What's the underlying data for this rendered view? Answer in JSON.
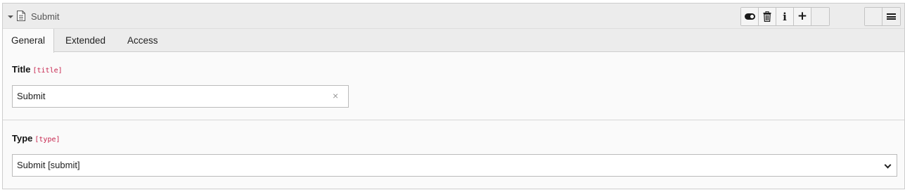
{
  "header": {
    "title": "Submit",
    "icons": [
      "collapse-caret-icon",
      "document-icon"
    ],
    "toolbar": [
      "toggle-visibility-icon",
      "trash-icon",
      "info-icon",
      "plus-icon",
      "blank",
      "blank",
      "menu-icon"
    ]
  },
  "tabs": [
    {
      "label": "General",
      "active": true
    },
    {
      "label": "Extended",
      "active": false
    },
    {
      "label": "Access",
      "active": false
    }
  ],
  "fields": {
    "title": {
      "label": "Title",
      "key": "[title]",
      "value": "Submit",
      "clear_glyph": "×"
    },
    "type": {
      "label": "Type",
      "key": "[type]",
      "value": "Submit [submit]"
    }
  },
  "colors": {
    "field_key": "#c7254e",
    "header_bg": "#ececec",
    "panel_bg": "#fafafa"
  }
}
